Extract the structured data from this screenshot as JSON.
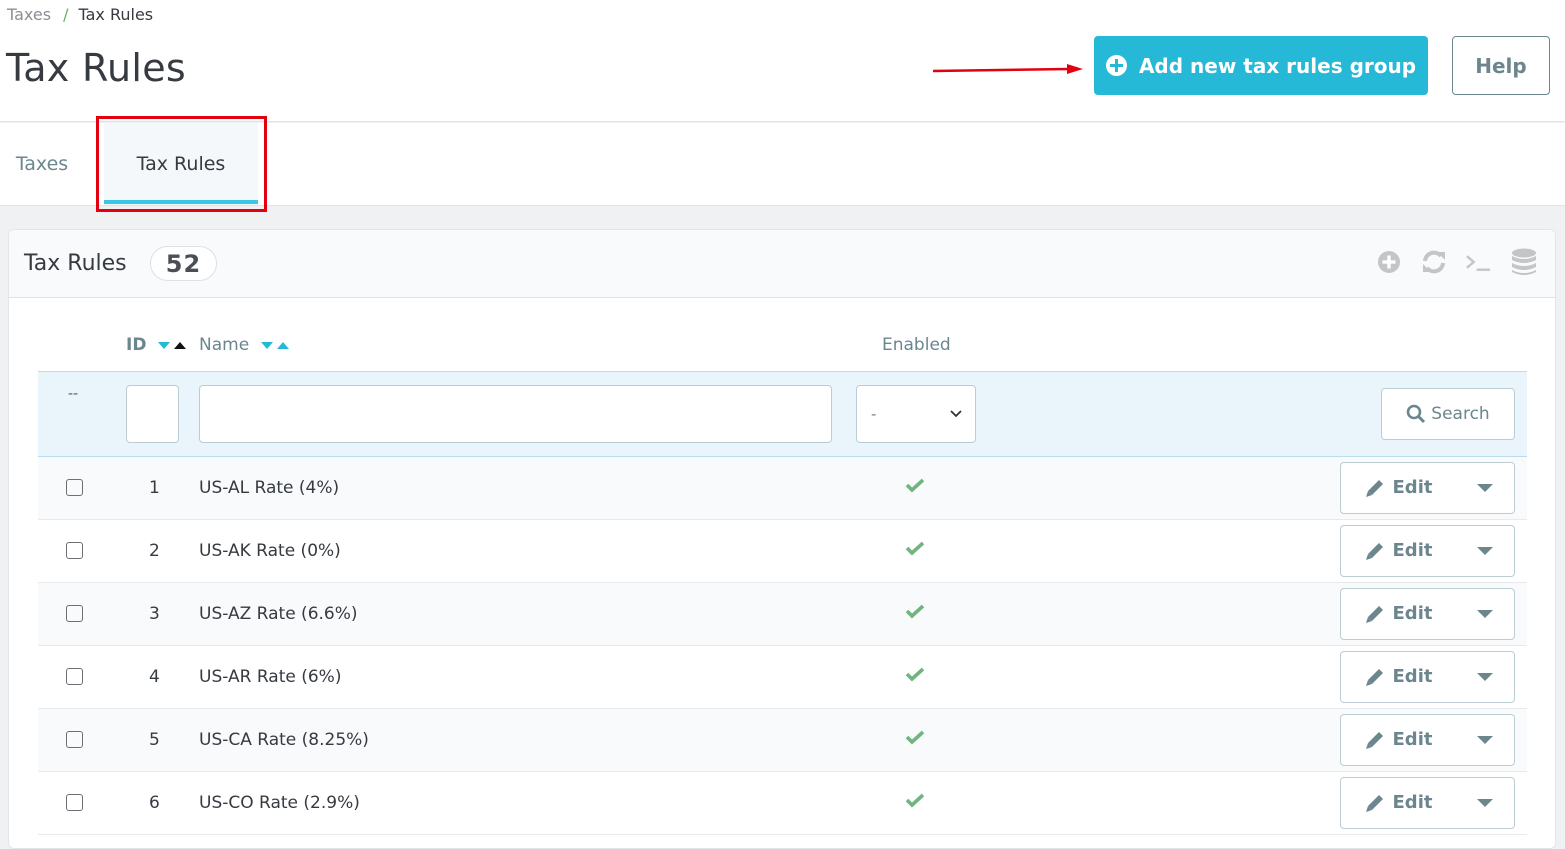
{
  "breadcrumb": {
    "parent": "Taxes",
    "separator": "/",
    "current": "Tax Rules"
  },
  "page": {
    "title": "Tax Rules"
  },
  "toolbar": {
    "add_label": "Add new tax rules group",
    "help_label": "Help"
  },
  "tabs": [
    {
      "label": "Taxes",
      "active": false
    },
    {
      "label": "Tax Rules",
      "active": true
    }
  ],
  "panel": {
    "title": "Tax Rules",
    "count": "52",
    "tools": [
      "add-icon",
      "refresh-icon",
      "sql-query-icon",
      "database-export-icon"
    ]
  },
  "table": {
    "columns": {
      "id": "ID",
      "name": "Name",
      "enabled": "Enabled"
    },
    "filters": {
      "bulk_placeholder": "--",
      "id_value": "",
      "name_value": "",
      "enabled_selected": "-",
      "search_label": "Search"
    },
    "rows": [
      {
        "id": "1",
        "name": "US-AL Rate (4%)",
        "enabled": true,
        "action": "Edit"
      },
      {
        "id": "2",
        "name": "US-AK Rate (0%)",
        "enabled": true,
        "action": "Edit"
      },
      {
        "id": "3",
        "name": "US-AZ Rate (6.6%)",
        "enabled": true,
        "action": "Edit"
      },
      {
        "id": "4",
        "name": "US-AR Rate (6%)",
        "enabled": true,
        "action": "Edit"
      },
      {
        "id": "5",
        "name": "US-CA Rate (8.25%)",
        "enabled": true,
        "action": "Edit"
      },
      {
        "id": "6",
        "name": "US-CO Rate (2.9%)",
        "enabled": true,
        "action": "Edit"
      }
    ]
  },
  "colors": {
    "accent": "#25b9d7",
    "tab_underline": "#3ac7e6",
    "success": "#70b580",
    "annotation": "#e3000f"
  }
}
